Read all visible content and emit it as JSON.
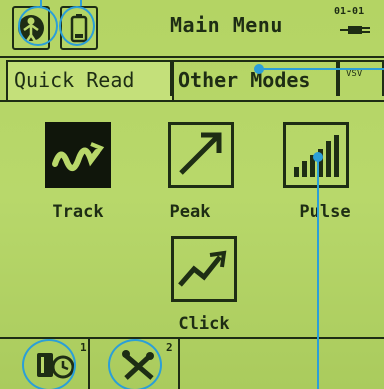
{
  "header": {
    "title": "Main Menu",
    "time": "01-01"
  },
  "tabs": [
    {
      "label": "Quick Read"
    },
    {
      "label": "Other Modes"
    },
    {
      "label": "VSV"
    }
  ],
  "modes": [
    {
      "label": "Track",
      "icon": "track-wave-icon"
    },
    {
      "label": "Peak",
      "icon": "peak-arrow-icon"
    },
    {
      "label": "Pulse",
      "icon": "pulse-bars-icon"
    },
    {
      "label": "Click",
      "icon": "click-zigzag-icon"
    }
  ],
  "bottombar": {
    "slot1_number": "1",
    "slot2_number": "2"
  },
  "colors": {
    "lcd_background": "#b9d86a",
    "ink": "#1e2d14",
    "callout": "#2b9fd8"
  }
}
